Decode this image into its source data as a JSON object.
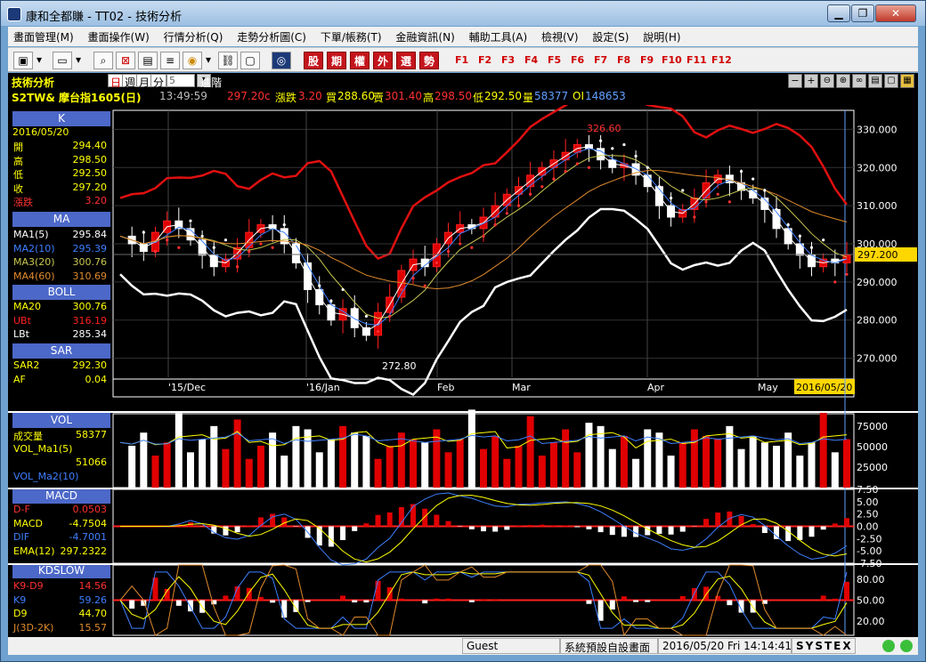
{
  "window": {
    "title": "康和全都賺 - TT02 - 技術分析"
  },
  "menu": [
    "畫面管理(M)",
    "畫面操作(W)",
    "行情分析(Q)",
    "走勢分析圖(C)",
    "下單/帳務(T)",
    "金融資訊(N)",
    "輔助工具(A)",
    "檢視(V)",
    "設定(S)",
    "說明(H)"
  ],
  "toolbar": {
    "red_buttons": [
      "股",
      "期",
      "權",
      "外",
      "選",
      "勢"
    ],
    "fkeys": [
      "F1",
      "F2",
      "F3",
      "F4",
      "F5",
      "F6",
      "F7",
      "F8",
      "F9",
      "F10",
      "F11",
      "F12"
    ]
  },
  "chart_header": {
    "title": "技術分析",
    "periods": [
      "日",
      "週",
      "月",
      "分"
    ],
    "period_value": "5",
    "advanced": "進階",
    "symbol_line": "S2TW& 摩台指1605(日)",
    "time": "13:49:59",
    "price": "297.20c",
    "change_label": "漲跌",
    "change": "3.20",
    "bid_label": "買",
    "bid": "288.60",
    "ask_label": "賣",
    "ask": "301.40",
    "high_label": "高",
    "high": "298.50",
    "low_label": "低",
    "low": "292.50",
    "vol_label": "量",
    "vol": "58377",
    "oi_label": "OI",
    "oi": "148653"
  },
  "sidebar": {
    "k_title": "K",
    "date": "2016/05/20",
    "k_rows": [
      {
        "k": "開",
        "v": "294.40",
        "c": "#ffff00"
      },
      {
        "k": "高",
        "v": "298.50",
        "c": "#ffff00"
      },
      {
        "k": "低",
        "v": "292.50",
        "c": "#ffff00"
      },
      {
        "k": "收",
        "v": "297.20",
        "c": "#ffff00"
      },
      {
        "k": "漲跌",
        "v": "3.20",
        "c": "#ff3030"
      }
    ],
    "ma_title": "MA",
    "ma_rows": [
      {
        "k": "MA1(5)",
        "v": "295.84",
        "c": "#ffffff"
      },
      {
        "k": "MA2(10)",
        "v": "295.39",
        "c": "#3d7fff"
      },
      {
        "k": "MA3(20)",
        "v": "300.76",
        "c": "#c8c850"
      },
      {
        "k": "MA4(60)",
        "v": "310.69",
        "c": "#e08a2c"
      }
    ],
    "boll_title": "BOLL",
    "boll_rows": [
      {
        "k": "MA20",
        "v": "300.76",
        "c": "#ffff00"
      },
      {
        "k": "UBt",
        "v": "316.19",
        "c": "#ff2020"
      },
      {
        "k": "LBt",
        "v": "285.34",
        "c": "#ffffff"
      }
    ],
    "sar_title": "SAR",
    "sar_rows": [
      {
        "k": "SAR2",
        "v": "292.30",
        "c": "#ffff00"
      },
      {
        "k": "AF",
        "v": "0.04",
        "c": "#ffff00"
      }
    ],
    "vol_title": "VOL",
    "vol_rows": [
      {
        "k": "成交量",
        "v": "58377",
        "c": "#ffff00"
      },
      {
        "k": "VOL_Ma1(5)",
        "v": "",
        "c": "#ffff00"
      },
      {
        "k": "",
        "v": "51066",
        "c": "#ffff00"
      },
      {
        "k": "VOL_Ma2(10)",
        "v": "",
        "c": "#3d7fff"
      }
    ],
    "macd_title": "MACD",
    "macd_rows": [
      {
        "k": "D-F",
        "v": "0.0503",
        "c": "#ff3030"
      },
      {
        "k": "MACD",
        "v": "-4.7504",
        "c": "#ffff00"
      },
      {
        "k": "DIF",
        "v": "-4.7001",
        "c": "#3d7fff"
      },
      {
        "k": "EMA(12)",
        "v": "297.2322",
        "c": "#ffff00"
      }
    ],
    "kd_title": "KDSLOW",
    "kd_rows": [
      {
        "k": "K9-D9",
        "v": "14.56",
        "c": "#ff3030"
      },
      {
        "k": "K9",
        "v": "59.26",
        "c": "#3d7fff"
      },
      {
        "k": "D9",
        "v": "44.70",
        "c": "#ffff00"
      },
      {
        "k": "J(3D-2K)",
        "v": "15.57",
        "c": "#e08a2c"
      }
    ]
  },
  "main_chart": {
    "y_ticks": [
      "330.000",
      "320.000",
      "310.000",
      "300.000",
      "290.000",
      "280.000",
      "270.000"
    ],
    "current_price_tag": "297.200",
    "x_labels": [
      "'15/Dec",
      "'16/Jan",
      "Feb",
      "Mar",
      "Apr",
      "May"
    ],
    "cursor_date": "2016/05/20",
    "high_marker": "326.60",
    "low_marker": "272.80"
  },
  "vol_chart": {
    "y_ticks": [
      "75000",
      "50000",
      "25000"
    ]
  },
  "macd_chart": {
    "y_ticks": [
      "7.50",
      "5.00",
      "2.50",
      "0.00",
      "-2.50",
      "-5.00",
      "-7.50"
    ]
  },
  "kd_chart": {
    "y_ticks": [
      "80.00",
      "50.00",
      "20.00"
    ]
  },
  "status": {
    "user": "Guest",
    "layout": "系統預設自設畫面",
    "datetime": "2016/05/20 Fri 14:14:41",
    "brand": "SYSTEX"
  },
  "chart_data": {
    "type": "candlestick",
    "instrument": "摩台指1605(日)",
    "x_range": [
      "2015-11",
      "2016-05-20"
    ],
    "ylim": [
      265,
      335
    ],
    "close_path": [
      302,
      300,
      298,
      303,
      306,
      304,
      301,
      297,
      294,
      296,
      299,
      303,
      305,
      304,
      300,
      295,
      288,
      284,
      280,
      283,
      278,
      276,
      282,
      286,
      293,
      296,
      294,
      300,
      303,
      305,
      304,
      307,
      310,
      313,
      315,
      318,
      320,
      322,
      324,
      326,
      325,
      322,
      320,
      321,
      318,
      315,
      310,
      307,
      309,
      312,
      316,
      318,
      316,
      314,
      312,
      309,
      304,
      300,
      297,
      294,
      296,
      295,
      297
    ],
    "high_marker": 326.6,
    "low_marker": 272.8,
    "last_close": 297.2
  }
}
